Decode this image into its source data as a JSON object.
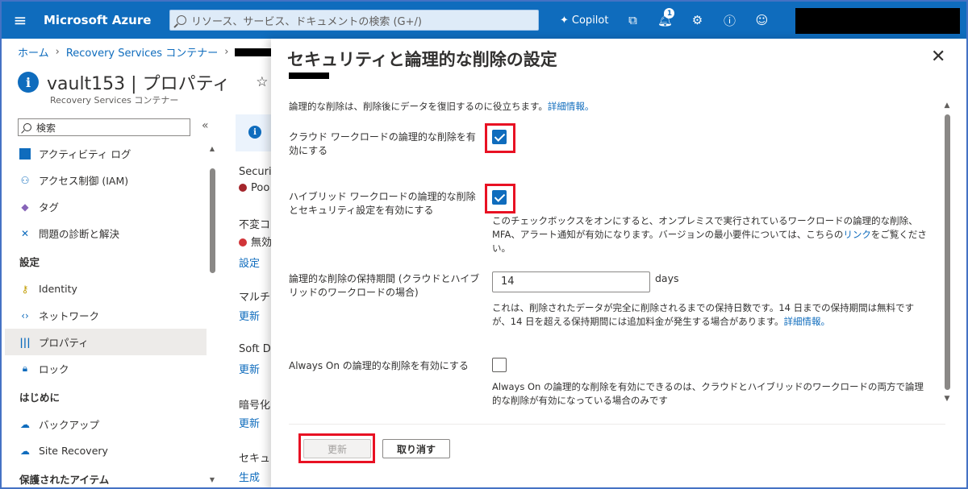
{
  "topbar": {
    "brand": "Microsoft Azure",
    "search_placeholder": "リソース、サービス、ドキュメントの検索 (G+/)",
    "copilot": "Copilot",
    "notification_count": "1"
  },
  "breadcrumb": {
    "home": "ホーム",
    "container": "Recovery Services コンテナー"
  },
  "page": {
    "title": "vault153 | プロパティ",
    "subtitle": "Recovery Services コンテナー"
  },
  "nav": {
    "search": "検索",
    "items": [
      {
        "label": "アクティビティ ログ"
      },
      {
        "label": "アクセス制御 (IAM)"
      },
      {
        "label": "タグ"
      },
      {
        "label": "問題の診断と解決"
      }
    ],
    "section_settings": "設定",
    "settings_items": [
      {
        "label": "Identity"
      },
      {
        "label": "ネットワーク"
      },
      {
        "label": "プロパティ"
      },
      {
        "label": "ロック"
      }
    ],
    "section_getting_started": "はじめに",
    "getting_started_items": [
      {
        "label": "バックアップ"
      },
      {
        "label": "Site Recovery"
      }
    ],
    "section_protected": "保護されたアイテム"
  },
  "middle": {
    "security_heading": "Securi",
    "security_status": "Poo",
    "immutable_heading": "不変コ",
    "immutable_status": "無効",
    "link_settings": "設定",
    "multi_heading": "マルチコ",
    "link_update_1": "更新",
    "soft_heading": "Soft D",
    "link_update_2": "更新",
    "encryption_heading": "暗号化",
    "link_update_3": "更新",
    "security2_heading": "セキュリ",
    "link_generate": "生成"
  },
  "blade": {
    "title": "セキュリティと論理的な削除の設定",
    "description": "論理的な削除は、削除後にデータを復旧するのに役立ちます。",
    "learn_more": "詳細情報。",
    "cloud_label": "クラウド ワークロードの論理的な削除を有効にする",
    "cloud_checked": true,
    "hybrid_label": "ハイブリッド ワークロードの論理的な削除とセキュリティ設定を有効にする",
    "hybrid_checked": true,
    "hybrid_help_pre": "このチェックボックスをオンにすると、オンプレミスで実行されているワークロードの論理的な削除、MFA、アラート通知が有効になります。バージョンの最小要件については、こちらの",
    "hybrid_help_link": "リンク",
    "hybrid_help_post": "をご覧ください。",
    "retention_label": "論理的な削除の保持期間 (クラウドとハイブリッドのワークロードの場合)",
    "retention_value": "14",
    "retention_unit": "days",
    "retention_help": "これは、削除されたデータが完全に削除されるまでの保持日数です。14 日までの保持期間は無料ですが、14 日を超える保持期間には追加料金が発生する場合があります。",
    "retention_learn_more": "詳細情報。",
    "always_on_label": "Always On の論理的な削除を有効にする",
    "always_on_checked": false,
    "always_on_help": "Always On の論理的な削除を有効にできるのは、クラウドとハイブリッドのワークロードの両方で論理的な削除が有効になっている場合のみです",
    "update_button": "更新",
    "cancel_button": "取り消す"
  },
  "colors": {
    "accent": "#0f6cbd",
    "highlight": "#e81123"
  }
}
